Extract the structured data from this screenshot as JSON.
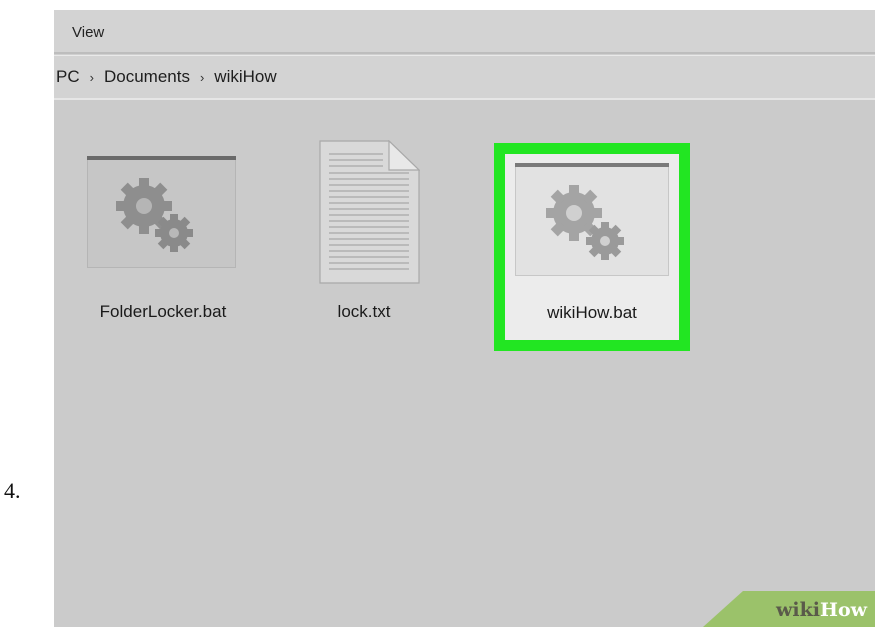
{
  "step": {
    "number": "4."
  },
  "menubar": {
    "view_label": "View"
  },
  "breadcrumb": [
    "PC",
    "Documents",
    "wikiHow"
  ],
  "breadcrumb_separator": "›",
  "files": [
    {
      "name": "FolderLocker.bat",
      "icon": "batch-file-gear-icon",
      "selected": false
    },
    {
      "name": "lock.txt",
      "icon": "text-document-icon",
      "selected": false
    },
    {
      "name": "wikiHow.bat",
      "icon": "batch-file-gear-icon",
      "selected": true
    }
  ],
  "colors": {
    "highlight": "#22e622",
    "window_bg": "#cbcbcb",
    "watermark_green": "#9bc26a"
  },
  "watermark": {
    "wiki": "wiki",
    "how": "How"
  }
}
